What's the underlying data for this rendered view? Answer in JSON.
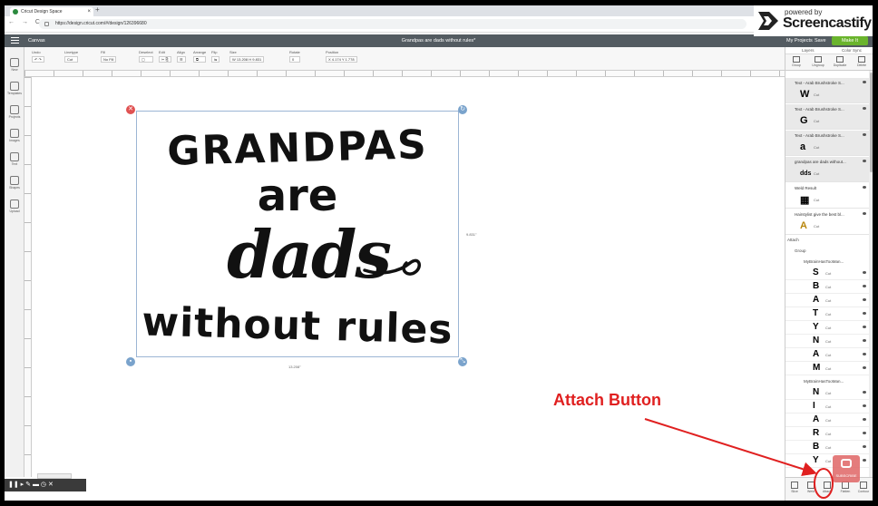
{
  "browser": {
    "tab_title": "Cricut Design Space",
    "new_tab": "+",
    "nav": "← → C",
    "url": "https://design.cricut.com/#/design/126396680"
  },
  "overlay": {
    "powered_by": "powered by",
    "brand": "Screencastify"
  },
  "header": {
    "canvas_label": "Canvas",
    "project_title": "Grandpas are dads without rules*",
    "my_projects": "My Projects",
    "save": "Save",
    "make": "Make It"
  },
  "toolbar": {
    "groups": [
      {
        "label": "Undo",
        "value": "↶ ↷"
      },
      {
        "label": "Linetype",
        "value": "Cut"
      },
      {
        "label": "Fill",
        "value": "No Fill"
      },
      {
        "label": "Deselect",
        "value": "▢"
      },
      {
        "label": "Edit",
        "value": "✂ ⎘"
      },
      {
        "label": "Align",
        "value": "☰"
      },
      {
        "label": "Arrange",
        "value": "⧉"
      },
      {
        "label": "Flip",
        "value": "⇋"
      },
      {
        "label": "Size",
        "value": "W 13.208  H 9.831"
      },
      {
        "label": "Rotate",
        "value": "0"
      },
      {
        "label": "Position",
        "value": "X 4.174  Y 1.778"
      }
    ]
  },
  "left_panel": {
    "items": [
      {
        "label": "New",
        "icon": "plus-icon"
      },
      {
        "label": "Templates",
        "icon": "shirt-icon"
      },
      {
        "label": "Projects",
        "icon": "projects-icon"
      },
      {
        "label": "Images",
        "icon": "image-icon"
      },
      {
        "label": "Text",
        "icon": "text-icon"
      },
      {
        "label": "Shapes",
        "icon": "shapes-icon"
      },
      {
        "label": "Upload",
        "icon": "upload-icon"
      }
    ]
  },
  "canvas": {
    "art_lines": [
      "GRANDPAS",
      "are",
      "dads",
      "without rules"
    ],
    "width_label": "13.208\"",
    "height_label": "9.831\""
  },
  "layers_panel": {
    "tabs": [
      "Layers",
      "Color Sync"
    ],
    "actions": [
      "Group",
      "Ungroup",
      "Duplicate",
      "Delete"
    ],
    "top_layers": [
      {
        "name": "Text - Arab Brushstroke S...",
        "glyph": "W",
        "op": "Cut"
      },
      {
        "name": "Text - Arab Brushstroke S...",
        "glyph": "G",
        "op": "Cut"
      },
      {
        "name": "Text - Arab Brushstroke S...",
        "glyph": "a",
        "op": "Cut"
      },
      {
        "name": "grandpas are dads without...",
        "glyph": "dds",
        "op": "Cut"
      },
      {
        "name": "Weld Result",
        "glyph": "▦",
        "op": "Cut"
      },
      {
        "name": "Hairstylist give the best bl...",
        "glyph": "A",
        "op": "Cut"
      }
    ],
    "attach": "Attach",
    "group": "Group",
    "subgroup1": "MyBrainHasTooMan...",
    "chars1": [
      "S",
      "B",
      "A",
      "T",
      "Y",
      "N",
      "A",
      "M"
    ],
    "subgroup2": "MyBrainHasTooMan...",
    "chars2": [
      "N",
      "I",
      "A",
      "R",
      "B",
      "Y"
    ],
    "op": "Cut",
    "bottom_actions": [
      "Slice",
      "Weld",
      "Attach",
      "Flatten",
      "Contour"
    ]
  },
  "youtube": {
    "label": "SUBSCRIBE"
  },
  "recorder": {
    "controls": "❚❚  ▸  ✎  ▬  ◷  ✕"
  },
  "annotation": {
    "text": "Attach Button",
    "color": "#e02020"
  }
}
